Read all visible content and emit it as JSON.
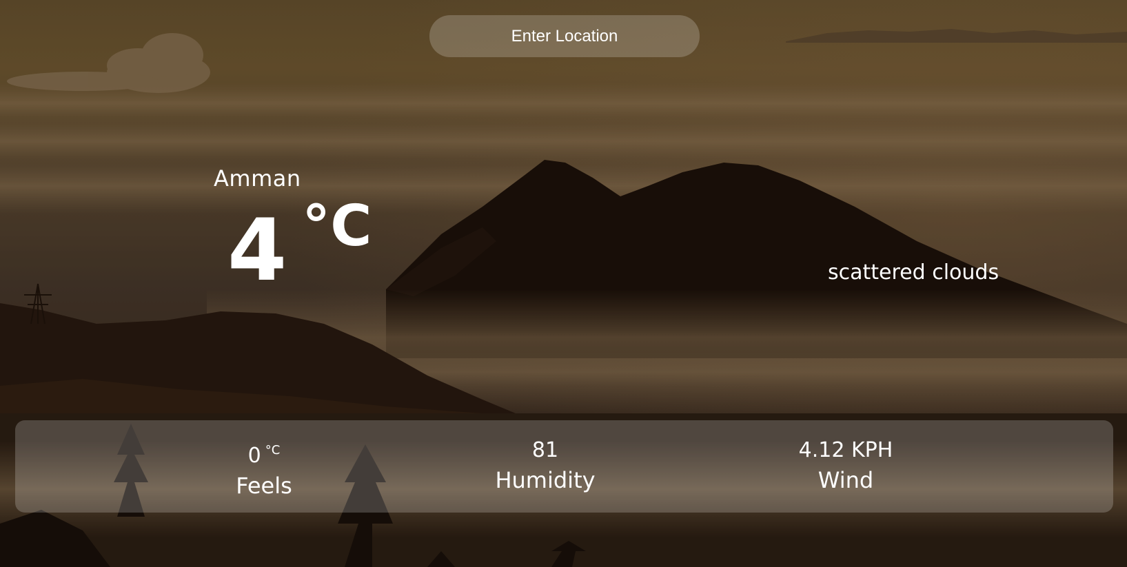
{
  "search": {
    "placeholder": "Enter Location"
  },
  "location": {
    "city": "Amman"
  },
  "current": {
    "temperature": "4",
    "unit": "°C",
    "description": "scattered clouds"
  },
  "stats": {
    "feels": {
      "value": "0",
      "unit": "°C",
      "label": "Feels"
    },
    "humidity": {
      "value": "81",
      "label": "Humidity"
    },
    "wind": {
      "value": "4.12 KPH",
      "label": "Wind"
    }
  },
  "colors": {
    "text": "#ffffff",
    "panel": "rgba(255,255,255,0.2)",
    "sky": "#6b5530",
    "mountain": "#1e120a"
  }
}
